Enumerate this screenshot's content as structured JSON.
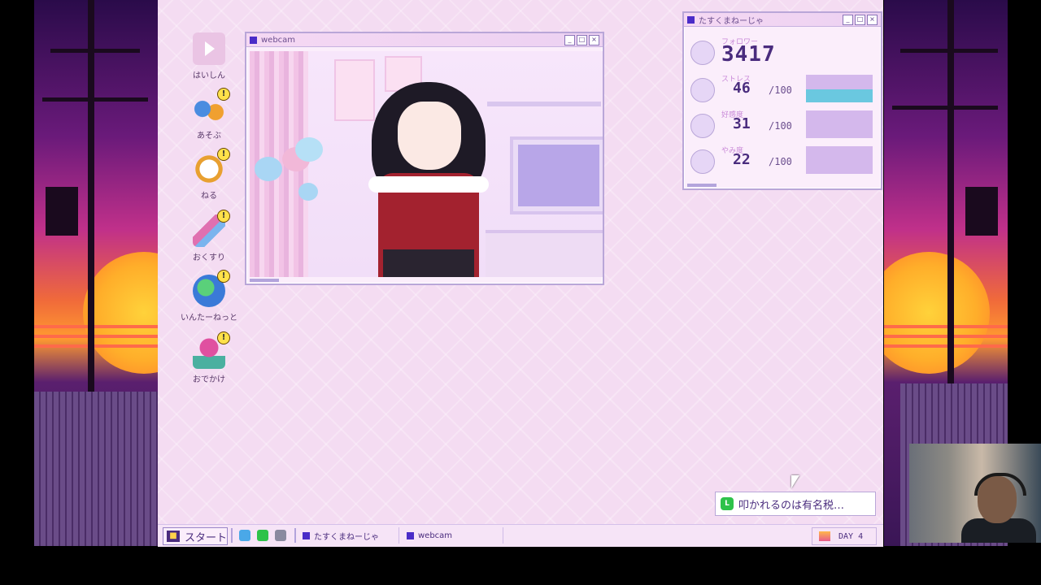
{
  "desktop_icons": [
    {
      "id": "haishin",
      "label": "はいしん",
      "icon": "play-video-icon",
      "badge": ""
    },
    {
      "id": "asobu",
      "label": "あそぶ",
      "icon": "game-controller-icon",
      "badge": "!"
    },
    {
      "id": "neru",
      "label": "ねる",
      "icon": "alarm-clock-icon",
      "badge": "!"
    },
    {
      "id": "okusuri",
      "label": "おくすり",
      "icon": "pill-icon",
      "badge": "!"
    },
    {
      "id": "internet",
      "label": "いんたーねっと",
      "icon": "globe-search-icon",
      "badge": "!"
    },
    {
      "id": "odekake",
      "label": "おでかけ",
      "icon": "map-pin-icon",
      "badge": "!"
    }
  ],
  "webcam_window": {
    "title": "webcam"
  },
  "stats_window": {
    "title": "たすくまねーじゃ",
    "followers": {
      "label": "フォロワー",
      "value": "3417"
    },
    "stats": [
      {
        "label": "ストレス",
        "value": "46",
        "max": "/100",
        "level": 0.46,
        "fill_color": "#6ac8e0"
      },
      {
        "label": "好感度",
        "value": "31",
        "max": "/100",
        "level": 0.31,
        "fill_color": "#d4b8ec"
      },
      {
        "label": "やみ度",
        "value": "22",
        "max": "/100",
        "level": 0.22,
        "fill_color": "#d4b8ec"
      }
    ]
  },
  "notification": {
    "text": "叩かれるのは有名税…",
    "icon": "line-chat-icon"
  },
  "taskbar": {
    "start_label": "スタート",
    "tasks": [
      "たすくまねーじゃ",
      "webcam"
    ],
    "day": "DAY 4"
  },
  "colors": {
    "accent": "#4a2cc8",
    "desktop_bg": "#f4dcf2",
    "text": "#4a2c7e"
  }
}
